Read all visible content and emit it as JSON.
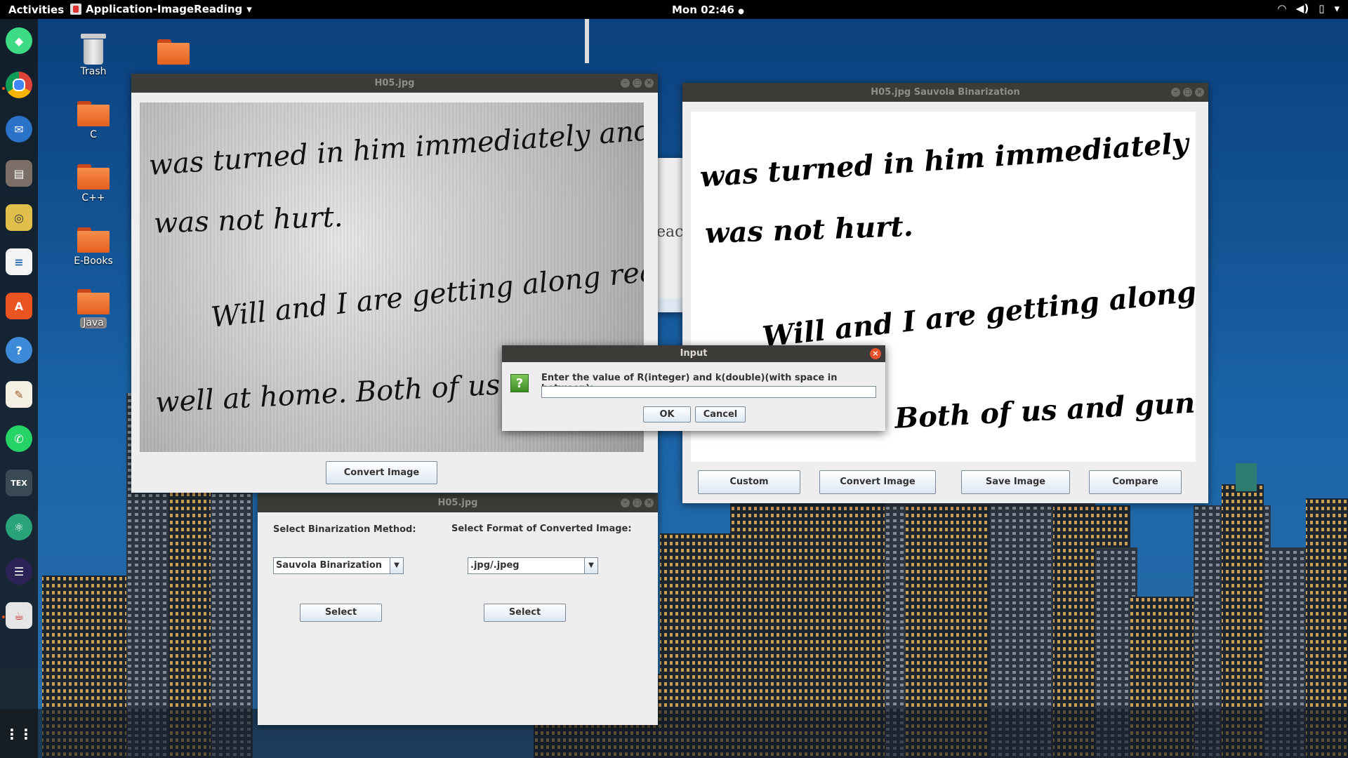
{
  "topbar": {
    "activities": "Activities",
    "app_name": "Application-ImageReading",
    "clock": "Mon 02:46",
    "clock_dot": "●"
  },
  "desktop": {
    "icons": [
      {
        "label": "Trash"
      },
      {
        "label": "C"
      },
      {
        "label": "C++"
      },
      {
        "label": "E-Books"
      },
      {
        "label": "Java"
      }
    ]
  },
  "dock": {
    "items": [
      {
        "name": "android-studio-icon",
        "glyph": "◆"
      },
      {
        "name": "chrome-icon",
        "glyph": "◉"
      },
      {
        "name": "thunderbird-icon",
        "glyph": "✉"
      },
      {
        "name": "files-icon",
        "glyph": "▤"
      },
      {
        "name": "rhythmbox-icon",
        "glyph": "◎"
      },
      {
        "name": "libreoffice-writer-icon",
        "glyph": "≡"
      },
      {
        "name": "software-center-icon",
        "glyph": "A"
      },
      {
        "name": "help-icon",
        "glyph": "?"
      },
      {
        "name": "text-editor-icon",
        "glyph": "✎"
      },
      {
        "name": "whatsapp-icon",
        "glyph": "✆"
      },
      {
        "name": "texmaker-icon",
        "glyph": "TEX"
      },
      {
        "name": "atom-icon",
        "glyph": "⚛"
      },
      {
        "name": "eclipse-icon",
        "glyph": "☰"
      },
      {
        "name": "java-app-icon",
        "glyph": "☕"
      },
      {
        "name": "app-grid-icon",
        "glyph": "⋮⋮"
      }
    ]
  },
  "original_window": {
    "title": "H05.jpg",
    "convert_button": "Convert Image",
    "handwriting": [
      "was turned in him immediately and he",
      "was not hurt.",
      "Will and I are getting along real",
      "well at home. Both of us and"
    ]
  },
  "options_window": {
    "title": "H05.jpg",
    "method_label": "Select Binarization Method:",
    "format_label": "Select Format of Converted Image:",
    "method_value": "Sauvola Binarization",
    "format_value": ".jpg/.jpeg",
    "select_button_1": "Select",
    "select_button_2": "Select"
  },
  "binarized_window": {
    "title": "H05.jpg Sauvola Binarization",
    "buttons": {
      "custom": "Custom",
      "convert": "Convert Image",
      "save": "Save Image",
      "compare": "Compare"
    },
    "handwriting": [
      "was turned in him immediately and he",
      "was not hurt.",
      "Will and I are getting along real",
      "Both of us and gunning"
    ]
  },
  "background_window": {
    "partial_text": "eac"
  },
  "dialog": {
    "title": "Input",
    "icon_glyph": "?",
    "prompt": "Enter the value of R(integer) and k(double)(with space in between):",
    "input_value": "",
    "ok": "OK",
    "cancel": "Cancel"
  },
  "colors": {
    "titlebar": "#3c3b37",
    "window_bg": "#eeeeee",
    "close_button": "#e5532d",
    "sky": "#0e4e8e"
  }
}
